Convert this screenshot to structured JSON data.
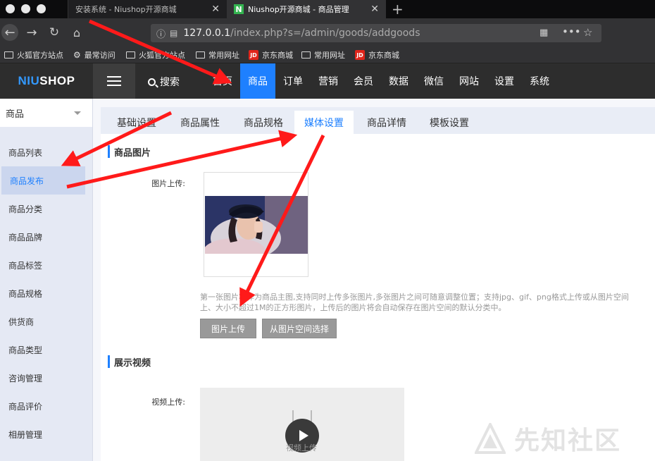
{
  "browser": {
    "tabs": [
      {
        "title": "安装系统 - Niushop开源商城",
        "active": false
      },
      {
        "title": "Niushop开源商城 - 商品管理",
        "active": true
      }
    ],
    "favicon_letter": "N",
    "url_host": "127.0.0.1",
    "url_path": "/index.php?s=/admin/goods/addgoods",
    "bookmarks": [
      {
        "label": "火狐官方站点",
        "icon": "folder-icon"
      },
      {
        "label": "最常访问",
        "icon": "gear-icon"
      },
      {
        "label": "火狐官方站点",
        "icon": "folder-icon"
      },
      {
        "label": "常用网址",
        "icon": "folder-icon"
      },
      {
        "label": "京东商城",
        "icon": "jd-icon"
      },
      {
        "label": "常用网址",
        "icon": "folder-icon"
      },
      {
        "label": "京东商城",
        "icon": "jd-icon"
      }
    ],
    "jd_icon_text": "JD"
  },
  "header": {
    "logo_part1": "NIU",
    "logo_part2": "SHOP",
    "search_label": "搜索",
    "nav": [
      "首页",
      "商品",
      "订单",
      "营销",
      "会员",
      "数据",
      "微信",
      "网站",
      "设置",
      "系统"
    ],
    "active_nav": "商品"
  },
  "sidebar": {
    "title": "商品",
    "items": [
      "商品列表",
      "商品发布",
      "商品分类",
      "商品品牌",
      "商品标签",
      "商品规格",
      "供货商",
      "商品类型",
      "咨询管理",
      "商品评价",
      "相册管理"
    ],
    "active_item": "商品发布"
  },
  "main": {
    "tabs": [
      "基础设置",
      "商品属性",
      "商品规格",
      "媒体设置",
      "商品详情",
      "模板设置"
    ],
    "active_tab": "媒体设置",
    "image_section_title": "商品图片",
    "image_upload_label": "图片上传:",
    "image_hint_line1": "第一张图片将作为商品主图,支持同时上传多张图片,多张图片之间可随意调整位置；支持jpg、gif、png格式上传或从图片空间",
    "image_hint_line2": "上、大小不超过1M的正方形图片，上传后的图片将会自动保存在图片空间的默认分类中。",
    "upload_button": "图片上传",
    "choose_from_space_button": "从图片空间选择",
    "video_section_title": "展示视频",
    "video_upload_label": "视频上传:",
    "video_upload_caption": "视频上传"
  },
  "watermark": "先知社区",
  "colors": {
    "accent": "#1e80ff",
    "arrow": "#ff1a1a",
    "header_bg": "#2d2d2d",
    "sidebar_bg": "#e5e9f4"
  }
}
